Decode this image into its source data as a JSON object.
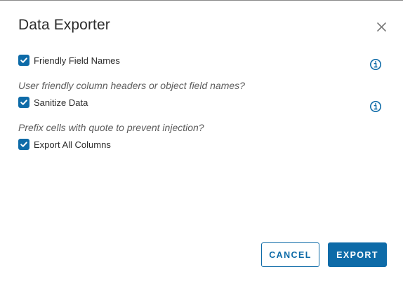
{
  "dialog": {
    "title": "Data Exporter",
    "close_icon": "close-icon"
  },
  "options": [
    {
      "label": "Friendly Field Names",
      "checked": true,
      "hint": "User friendly column headers or object field names?",
      "info_icon": "info-icon"
    },
    {
      "label": "Sanitize Data",
      "checked": true,
      "hint": "Prefix cells with quote to prevent injection?",
      "info_icon": "info-icon"
    },
    {
      "label": "Export All Columns",
      "checked": true
    }
  ],
  "footer": {
    "cancel_label": "CANCEL",
    "export_label": "EXPORT"
  },
  "colors": {
    "accent": "#0e6ba8",
    "text": "#2b2b2b",
    "hint_text": "#5c5c5c"
  }
}
